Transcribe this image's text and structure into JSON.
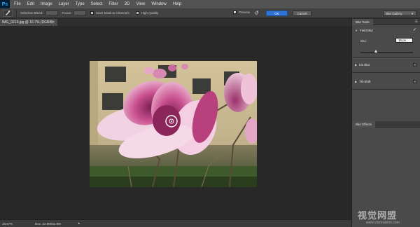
{
  "app": {
    "logo": "Ps"
  },
  "menu": [
    "File",
    "Edit",
    "Image",
    "Layer",
    "Type",
    "Select",
    "Filter",
    "3D",
    "View",
    "Window",
    "Help"
  ],
  "options_bar": {
    "tool_icon": "pin-brush-icon",
    "selection_bleed_label": "Selection Bleed:",
    "focus_label": "Focus:",
    "save_mask_label": "Save Mask to Channels",
    "high_quality_label": "High Quality",
    "preview_label": "Preview",
    "preview_checked": true,
    "reset_icon": "reset-icon",
    "ok_label": "OK",
    "cancel_label": "Cancel",
    "gallery_value": "Blur Gallery"
  },
  "document": {
    "tab_label": "IMG_0213.jpg @ 16.7% (RGB/8)",
    "close_glyph": "×",
    "photo_subject": "magnolia-photo"
  },
  "status": {
    "zoom": "16.67%",
    "doc_info": "Doc: 22.9M/22.9M",
    "arrow": "▸"
  },
  "panel": {
    "blur_tools_tab": "Blur Tools",
    "field_blur_label": "Field Blur",
    "field_blur_enabled": true,
    "blur_label": "Blur:",
    "blur_value": "15 px",
    "blur_slider_fraction": 0.3,
    "iris_blur_label": "Iris Blur",
    "tilt_shift_label": "Tilt-Shift",
    "blur_effects_tab": "Blur Effects"
  },
  "watermark": {
    "title": "视觉网盟",
    "url": "www.visionunion.com"
  },
  "colors": {
    "ok_button": "#2f74d6",
    "panel_bg": "#4a4a4a",
    "canvas_bg": "#282828"
  }
}
